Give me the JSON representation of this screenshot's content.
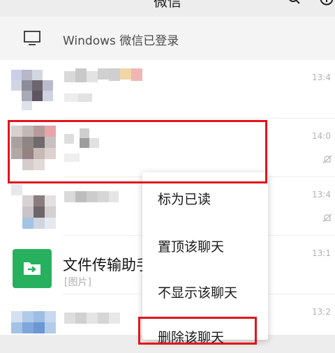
{
  "header": {
    "title": "微信",
    "search_icon": "search-icon",
    "add_icon": "plus-circle-icon"
  },
  "login_bar": {
    "icon": "monitor-icon",
    "text": "Windows 微信已登录"
  },
  "chats": [
    {
      "time": "13:4"
    },
    {
      "time": "14:0"
    },
    {
      "time": "13:4"
    },
    {
      "name": "文件传输助手",
      "preview": "[图片]",
      "time": "13:1"
    },
    {
      "time": "13:2"
    }
  ],
  "context_menu": {
    "items": [
      "标为已读",
      "置顶该聊天",
      "不显示该聊天",
      "删除该聊天"
    ]
  },
  "colors": {
    "highlight": "#e3141b",
    "file_transfer_green": "#27b15e",
    "background": "#ededed"
  }
}
